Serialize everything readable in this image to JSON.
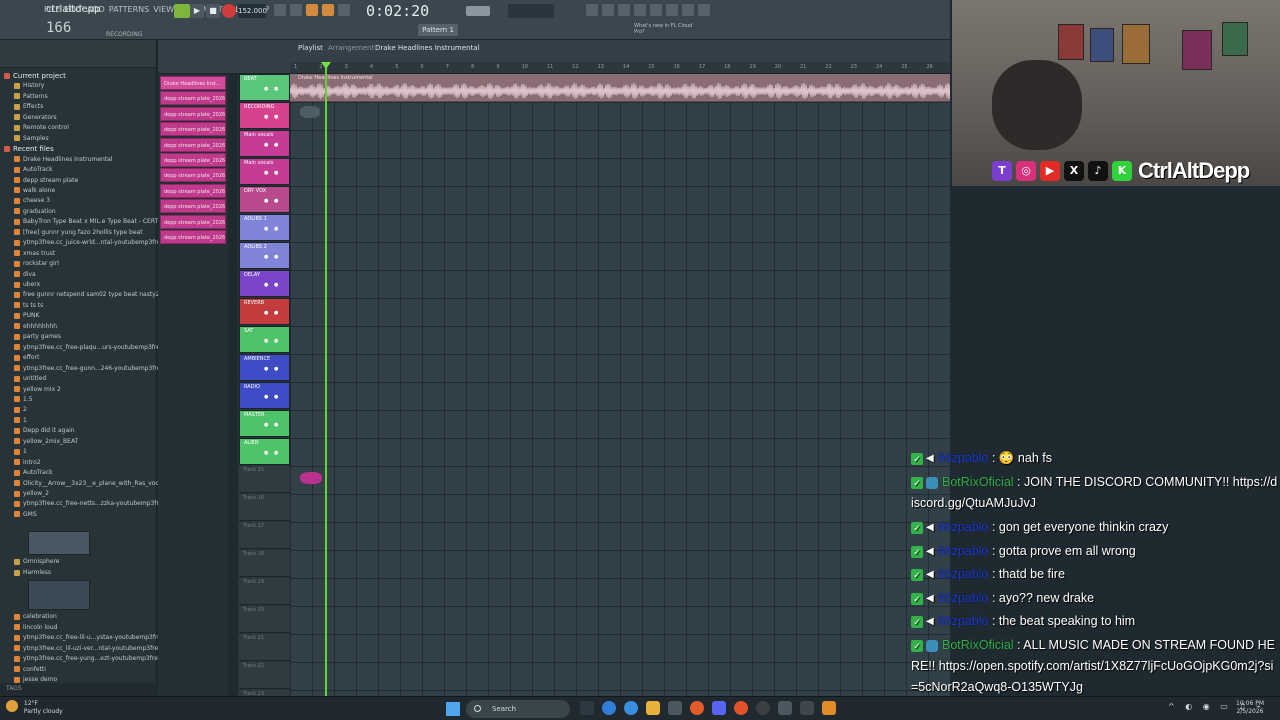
{
  "toolbar": {
    "brand": "ctrlaltdepp",
    "menu": [
      "FILE",
      "EDIT",
      "ADD",
      "PATTERNS",
      "VIEW",
      "OPTIONS",
      "TOOLS",
      "HELP"
    ],
    "cpu": "166",
    "recording_badge": "RECORDING",
    "tempo": "152.000",
    "clock": "0:02:20",
    "pattern": "Pattern 1",
    "news": "What's new in FL Cloud Pro?"
  },
  "playlist": {
    "title": "Playlist",
    "subtitle": "Arrangement",
    "name": "Drake  Headlines Instrumental",
    "clip_label": "Drake  Headlines Instrumental",
    "ruler_ticks": [
      "1",
      "2",
      "3",
      "4",
      "5",
      "6",
      "7",
      "8",
      "9",
      "10",
      "11",
      "12",
      "13",
      "14",
      "15",
      "16",
      "17",
      "18",
      "19",
      "20",
      "21",
      "22",
      "23",
      "24",
      "25",
      "26"
    ]
  },
  "picker": {
    "clips": [
      "Drake  Headlines Inst...",
      "depp stream plate_2026...",
      "depp stream plate_2026...",
      "depp stream plate_2026...",
      "depp stream plate_2026...",
      "depp stream plate_2026...",
      "depp stream plate_2026...",
      "depp stream plate_2026...",
      "depp stream plate_2026...",
      "depp stream plate_2026...",
      "depp stream plate_2026..."
    ]
  },
  "tracks": [
    {
      "name": "BEAT",
      "color": "#5bc77a"
    },
    {
      "name": "RECORDING",
      "color": "#d8418e"
    },
    {
      "name": "Main vocals",
      "color": "#c43c96"
    },
    {
      "name": "Main vocals",
      "color": "#c43c96"
    },
    {
      "name": "DRY VOX",
      "color": "#b94a8d"
    },
    {
      "name": "ADLIBS 1",
      "color": "#7f84d9"
    },
    {
      "name": "ADLIBS 2",
      "color": "#7f84d9"
    },
    {
      "name": "DELAY",
      "color": "#7a45c8"
    },
    {
      "name": "REVERB",
      "color": "#c43c3c"
    },
    {
      "name": "SAT",
      "color": "#4ec36a"
    },
    {
      "name": "AMBIENCE",
      "color": "#3f4cc6"
    },
    {
      "name": "RADIO",
      "color": "#3f4cc6"
    },
    {
      "name": "MASTER",
      "color": "#4ec36a"
    },
    {
      "name": "ALIEN",
      "color": "#4ec36a"
    }
  ],
  "empty_tracks": [
    "Track 15",
    "Track 16",
    "Track 17",
    "Track 18",
    "Track 19",
    "Track 20",
    "Track 21",
    "Track 22",
    "Track 23"
  ],
  "browser": {
    "items": [
      {
        "label": "Current project",
        "kind": "section"
      },
      {
        "label": "History",
        "kind": "folder"
      },
      {
        "label": "Patterns",
        "kind": "folder"
      },
      {
        "label": "Effects",
        "kind": "folder"
      },
      {
        "label": "Generators",
        "kind": "folder"
      },
      {
        "label": "Remote control",
        "kind": "folder"
      },
      {
        "label": "Samples",
        "kind": "folder"
      },
      {
        "label": "Recent files",
        "kind": "section"
      },
      {
        "label": "Drake  Headlines Instrumental",
        "kind": "file"
      },
      {
        "label": "AutoTrack",
        "kind": "file"
      },
      {
        "label": "depp stream plate",
        "kind": "file"
      },
      {
        "label": "walk alone",
        "kind": "file"
      },
      {
        "label": "cheese 3",
        "kind": "file"
      },
      {
        "label": "graduation",
        "kind": "file"
      },
      {
        "label": "BabyTron Type Beat x MIL.e Type Beat - CERTIFIED",
        "kind": "file"
      },
      {
        "label": "[free] gunnr  yung fazo  2hollis type beat",
        "kind": "file"
      },
      {
        "label": "ytmp3free.cc_juice-wrld...ntal-youtubemp3free.org",
        "kind": "file"
      },
      {
        "label": "xmas trust",
        "kind": "file"
      },
      {
        "label": "rockstar girl",
        "kind": "file"
      },
      {
        "label": "diva",
        "kind": "file"
      },
      {
        "label": "uberx",
        "kind": "file"
      },
      {
        "label": "free gunnr  netspend  sam02 type beat nasty2",
        "kind": "file"
      },
      {
        "label": "ts ts ts",
        "kind": "file"
      },
      {
        "label": "PUNK",
        "kind": "file"
      },
      {
        "label": "ehhhhhhhh",
        "kind": "file"
      },
      {
        "label": "party games",
        "kind": "file"
      },
      {
        "label": "ytmp3free.cc_free-plaqu...urs-youtubemp3free.org",
        "kind": "file"
      },
      {
        "label": "effort",
        "kind": "file"
      },
      {
        "label": "ytmp3free.cc_free-gunn...246-youtubemp3free.org",
        "kind": "file"
      },
      {
        "label": "untitled",
        "kind": "file"
      },
      {
        "label": "yellow mix 2",
        "kind": "file"
      },
      {
        "label": "1.5",
        "kind": "file"
      },
      {
        "label": "2",
        "kind": "file"
      },
      {
        "label": "1",
        "kind": "file"
      },
      {
        "label": "Depp did it again",
        "kind": "file"
      },
      {
        "label": "yellow_2mix_BEAT",
        "kind": "file"
      },
      {
        "label": "1",
        "kind": "file"
      },
      {
        "label": "intro2",
        "kind": "file"
      },
      {
        "label": "AutoTrack",
        "kind": "file"
      },
      {
        "label": "Olicity__Arrow__3x23__e_plane_with_Ras_vocal",
        "kind": "file"
      },
      {
        "label": "yellow_2",
        "kind": "file"
      },
      {
        "label": "ytmp3free.cc_free-netts...zzka-youtubemp3free.org",
        "kind": "file"
      },
      {
        "label": "GMS",
        "kind": "file"
      }
    ],
    "items_b": [
      {
        "label": "Omnisphere",
        "kind": "folder"
      },
      {
        "label": "Harmless",
        "kind": "folder"
      }
    ],
    "items_c": [
      {
        "label": "celebration",
        "kind": "file"
      },
      {
        "label": "lincoln loud",
        "kind": "file"
      },
      {
        "label": "ytmp3free.cc_free-lil-u...ystax-youtubemp3free.org",
        "kind": "file"
      },
      {
        "label": "ytmp3free.cc_lil-uzi-ver...ntal-youtubemp3free.org",
        "kind": "file"
      },
      {
        "label": "ytmp3free.cc_free-yung...ezt-youtubemp3free.org",
        "kind": "file"
      },
      {
        "label": "confetti",
        "kind": "file"
      },
      {
        "label": "jesse demo",
        "kind": "file"
      }
    ],
    "footer": "TAGS"
  },
  "webcam": {
    "handle": "CtrlAltDepp",
    "socials": [
      {
        "name": "twitch-icon",
        "glyph": "T",
        "color": "#7a3fd1"
      },
      {
        "name": "instagram-icon",
        "glyph": "◎",
        "color": "#d9307c"
      },
      {
        "name": "youtube-icon",
        "glyph": "▶",
        "color": "#e22b26"
      },
      {
        "name": "x-icon",
        "glyph": "X",
        "color": "#111111"
      },
      {
        "name": "tiktok-icon",
        "glyph": "♪",
        "color": "#111111"
      },
      {
        "name": "kick-icon",
        "glyph": "K",
        "color": "#2fd23a"
      }
    ]
  },
  "chat": [
    {
      "user": "66zpablo",
      "text": ": 😳 nah fs",
      "bot": false
    },
    {
      "user": "BotRixOficial",
      "text": ": JOIN THE DISCORD COMMUNITY!! https://discord.gg/QtuAMJuJvJ",
      "bot": true
    },
    {
      "user": "66zpablo",
      "text": ": gon get everyone thinkin crazy",
      "bot": false
    },
    {
      "user": "66zpablo",
      "text": ": gotta prove em all wrong",
      "bot": false
    },
    {
      "user": "66zpablo",
      "text": ": thatd be fire",
      "bot": false
    },
    {
      "user": "66zpablo",
      "text": ": ayo?? new drake",
      "bot": false
    },
    {
      "user": "66zpablo",
      "text": ": the beat speaking to him",
      "bot": false
    },
    {
      "user": "BotRixOficial",
      "text": ": ALL MUSIC MADE ON STREAM FOUND HERE!! https://open.spotify.com/artist/1X8Z77ljFcUoGOjpKG0m2j?si=5cNorR2aQwq8-O135WTYJg",
      "bot": true
    }
  ],
  "taskbar": {
    "weather_temp": "12°F",
    "weather_desc": "Partly cloudy",
    "search": "Search",
    "time": "10:06 PM",
    "date": "2/5/2026"
  }
}
